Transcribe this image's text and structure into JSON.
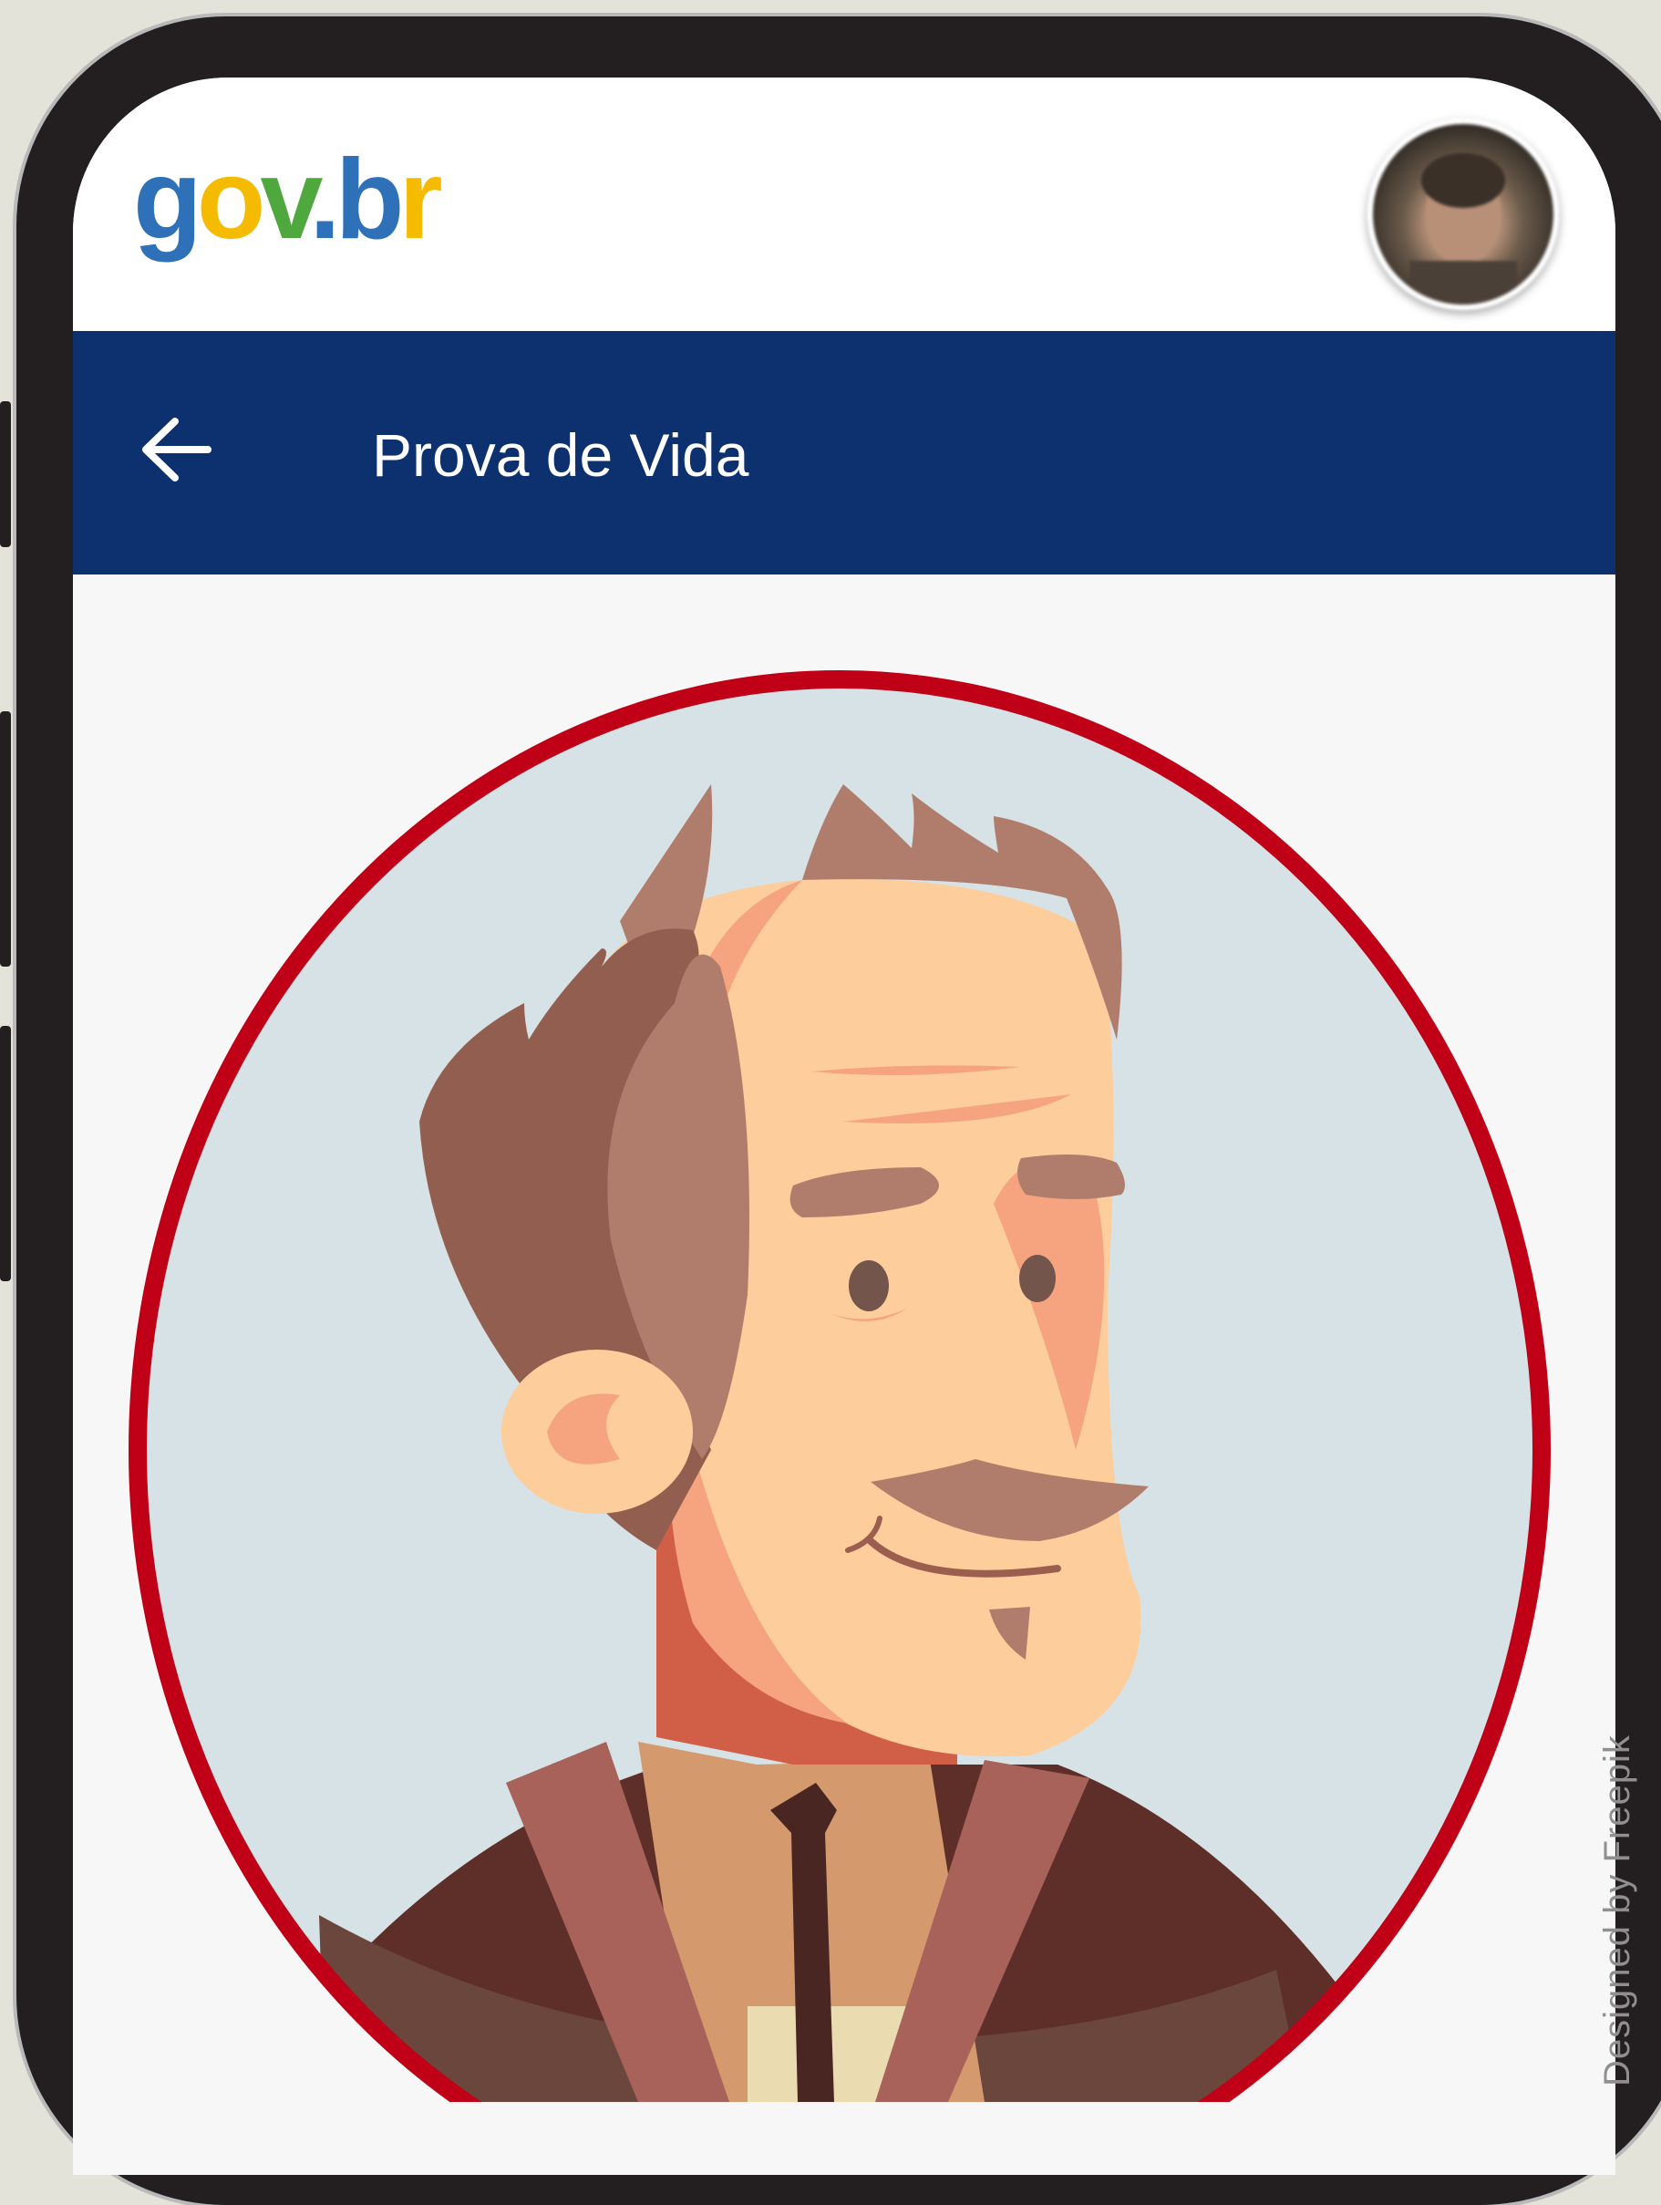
{
  "header": {
    "logo": {
      "g": "g",
      "o": "o",
      "v": "v",
      "dot": ".",
      "b": "b",
      "r": "r"
    },
    "logo_colors": {
      "blue": "#2f71b8",
      "yellow": "#f5bb00",
      "green": "#4fa83d",
      "dot": "#2f71b8"
    },
    "avatar_icon": "user-avatar-photo"
  },
  "navbar": {
    "back_icon": "arrow-left-icon",
    "title": "Prova de Vida",
    "background": "#0d316f"
  },
  "illustration": {
    "icon": "elderly-man-portrait",
    "frame_color": "#c00016",
    "background": "#d6e2e5"
  },
  "credit": "Designed by Freepik"
}
